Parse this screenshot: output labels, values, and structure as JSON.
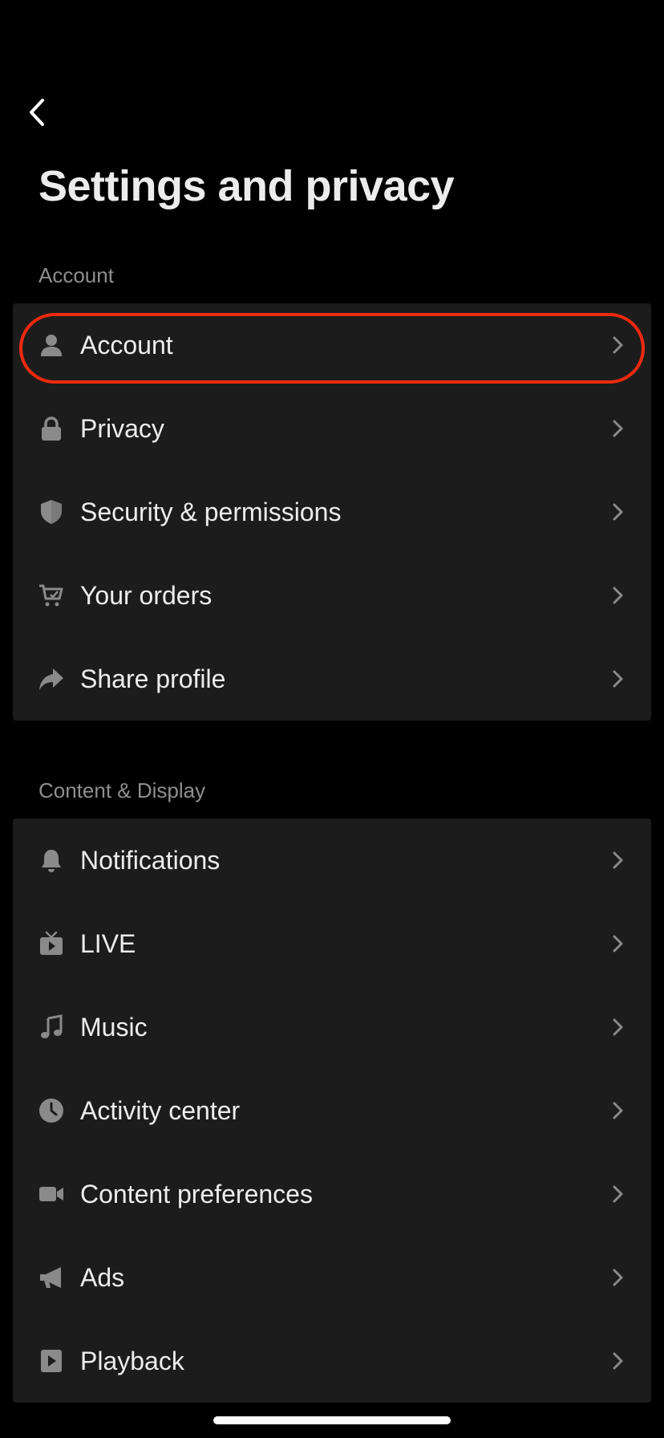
{
  "header": {
    "title": "Settings and privacy"
  },
  "sections": [
    {
      "label": "Account",
      "items": [
        {
          "label": "Account",
          "icon": "person-icon"
        },
        {
          "label": "Privacy",
          "icon": "lock-icon"
        },
        {
          "label": "Security & permissions",
          "icon": "shield-icon"
        },
        {
          "label": "Your orders",
          "icon": "cart-icon"
        },
        {
          "label": "Share profile",
          "icon": "share-icon"
        }
      ]
    },
    {
      "label": "Content & Display",
      "items": [
        {
          "label": "Notifications",
          "icon": "bell-icon"
        },
        {
          "label": "LIVE",
          "icon": "tv-icon"
        },
        {
          "label": "Music",
          "icon": "music-note-icon"
        },
        {
          "label": "Activity center",
          "icon": "clock-icon"
        },
        {
          "label": "Content preferences",
          "icon": "video-camera-icon"
        },
        {
          "label": "Ads",
          "icon": "megaphone-icon"
        },
        {
          "label": "Playback",
          "icon": "play-icon"
        }
      ]
    }
  ],
  "colors": {
    "background": "#000000",
    "group_background": "#1c1c1c",
    "icon": "#8a8a8a",
    "highlight": "#ee2a0f"
  }
}
